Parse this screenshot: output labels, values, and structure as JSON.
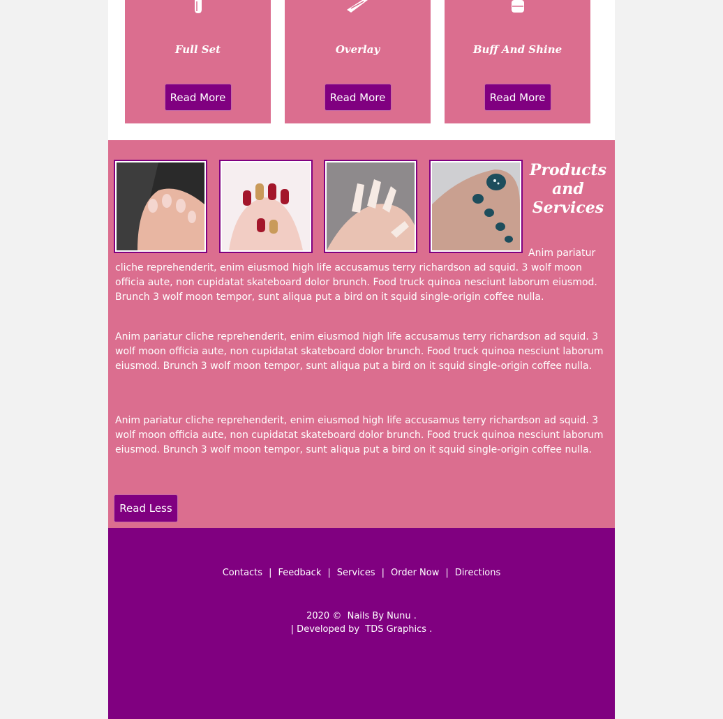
{
  "services": {
    "cards": [
      {
        "title": "Full Set",
        "button": "Read More"
      },
      {
        "title": "Overlay",
        "button": "Read More"
      },
      {
        "title": "Buff And Shine",
        "button": "Read More"
      }
    ]
  },
  "products": {
    "heading": "Products and Services",
    "paragraphs": [
      "Anim pariatur cliche reprehenderit, enim eiusmod high life accusamus terry richardson ad squid. 3 wolf moon officia aute, non cupidatat skateboard dolor brunch. Food truck quinoa nesciunt laborum eiusmod. Brunch 3 wolf moon tempor, sunt aliqua put a bird on it squid single-origin coffee nulla.",
      "Anim pariatur cliche reprehenderit, enim eiusmod high life accusamus terry richardson ad squid. 3 wolf moon officia aute, non cupidatat skateboard dolor brunch. Food truck quinoa nesciunt laborum eiusmod. Brunch 3 wolf moon tempor, sunt aliqua put a bird on it squid single-origin coffee nulla.",
      "Anim pariatur cliche reprehenderit, enim eiusmod high life accusamus terry richardson ad squid. 3 wolf moon officia aute, non cupidatat skateboard dolor brunch. Food truck quinoa nesciunt laborum eiusmod. Brunch 3 wolf moon tempor, sunt aliqua put a bird on it squid single-origin coffee nulla."
    ],
    "read_less": "Read Less"
  },
  "footer": {
    "nav": [
      "Contacts",
      "Feedback",
      "Services",
      "Order Now",
      "Directions"
    ],
    "separator": "|",
    "copyright_prefix": "2020 ©",
    "brand": "Nails By Nunu",
    "developed_prefix": "| Developed by",
    "developer": "TDS Graphics",
    "dot": "."
  },
  "colors": {
    "card_pink": "#db6e8f",
    "purple": "#800080",
    "white": "#ffffff"
  }
}
